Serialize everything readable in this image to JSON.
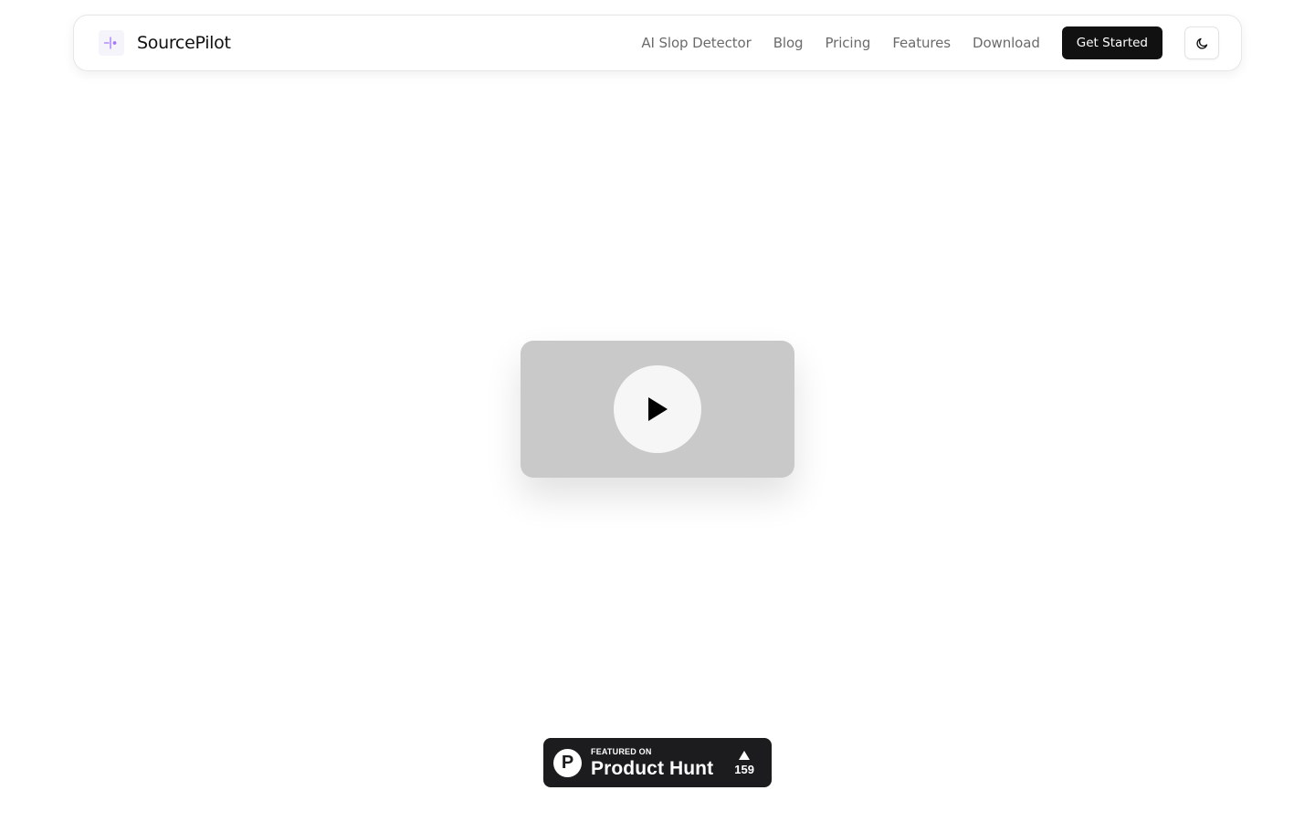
{
  "navbar": {
    "brand": {
      "name": "SourcePilot",
      "logo_icon": "sparkle-dot-icon",
      "logo_color": "#a575ff"
    },
    "links": [
      {
        "label": "AI Slop Detector"
      },
      {
        "label": "Blog"
      },
      {
        "label": "Pricing"
      },
      {
        "label": "Features"
      },
      {
        "label": "Download"
      }
    ],
    "cta_label": "Get Started",
    "theme_toggle_icon": "moon-icon"
  },
  "hero": {
    "video": {
      "play_icon": "play-icon",
      "background": "#c9c9c9"
    }
  },
  "product_hunt_badge": {
    "featured_label": "FEATURED ON",
    "name": "Product Hunt",
    "logo_letter": "P",
    "upvote_icon": "triangle-up-icon",
    "votes": "159"
  }
}
